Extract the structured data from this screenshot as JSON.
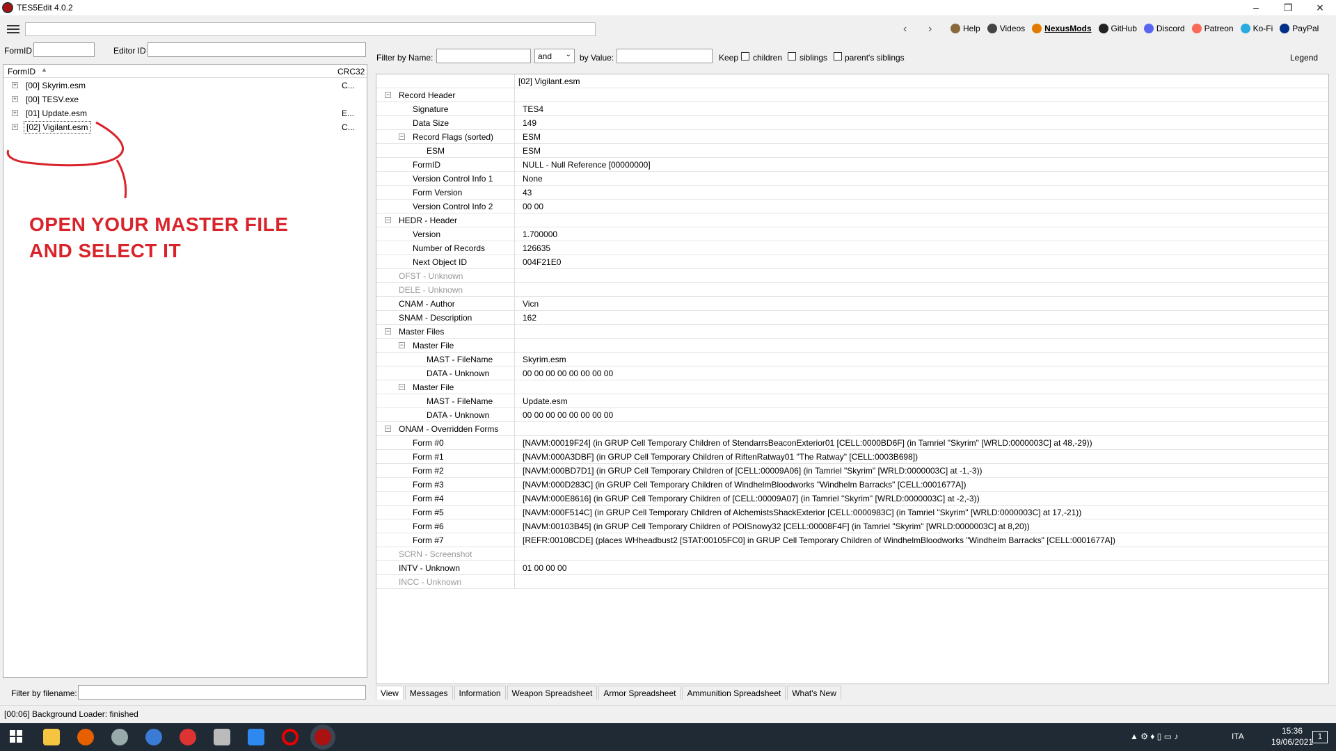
{
  "window": {
    "title": "TES5Edit 4.0.2",
    "minimize": "–",
    "maximize": "❐",
    "close": "✕"
  },
  "toolbar": {
    "links": [
      {
        "label": "Help",
        "color": "#8a6a3a"
      },
      {
        "label": "Videos",
        "color": "#444"
      },
      {
        "label": "NexusMods",
        "color": "#e07b00"
      },
      {
        "label": "GitHub",
        "color": "#222"
      },
      {
        "label": "Discord",
        "color": "#5865f2"
      },
      {
        "label": "Patreon",
        "color": "#f96854"
      },
      {
        "label": "Ko-Fi",
        "color": "#29abe0"
      },
      {
        "label": "PayPal",
        "color": "#003087"
      }
    ]
  },
  "left": {
    "formid_label": "FormID",
    "editorid_label": "Editor ID",
    "col_formid": "FormID",
    "col_crc": "CRC32",
    "files": [
      {
        "name": "[00] Skyrim.esm",
        "crc": "C..."
      },
      {
        "name": "[00] TESV.exe",
        "crc": ""
      },
      {
        "name": "[01] Update.esm",
        "crc": "E..."
      },
      {
        "name": "[02] Vigilant.esm",
        "crc": "C..."
      }
    ],
    "annotation_line1": "OPEN YOUR MASTER FILE",
    "annotation_line2": "AND SELECT IT",
    "filter_label": "Filter by filename:"
  },
  "right": {
    "filter_name_label": "Filter by Name:",
    "op_value": "and",
    "by_value_label": "by Value:",
    "keep_label": "Keep",
    "children_label": "children",
    "siblings_label": "siblings",
    "parents_siblings_label": "parent's siblings",
    "legend_label": "Legend",
    "header_file": "[02] Vigilant.esm",
    "rows": [
      {
        "k": "Record Header",
        "v": "",
        "lvl": 1,
        "exp": true
      },
      {
        "k": "Signature",
        "v": "TES4",
        "lvl": 2
      },
      {
        "k": "Data Size",
        "v": "149",
        "lvl": 2
      },
      {
        "k": "Record Flags (sorted)",
        "v": "ESM",
        "lvl": 2,
        "exp": true
      },
      {
        "k": "ESM",
        "v": "ESM",
        "lvl": 3
      },
      {
        "k": "FormID",
        "v": "NULL - Null Reference [00000000]",
        "lvl": 2
      },
      {
        "k": "Version Control Info 1",
        "v": "None",
        "lvl": 2
      },
      {
        "k": "Form Version",
        "v": "43",
        "lvl": 2
      },
      {
        "k": "Version Control Info 2",
        "v": "00 00",
        "lvl": 2
      },
      {
        "k": "HEDR - Header",
        "v": "",
        "lvl": 1,
        "exp": true
      },
      {
        "k": "Version",
        "v": "1.700000",
        "lvl": 2
      },
      {
        "k": "Number of Records",
        "v": "126635",
        "lvl": 2
      },
      {
        "k": "Next Object ID",
        "v": "004F21E0",
        "lvl": 2
      },
      {
        "k": "OFST - Unknown",
        "v": "",
        "lvl": 1,
        "dim": true
      },
      {
        "k": "DELE - Unknown",
        "v": "",
        "lvl": 1,
        "dim": true
      },
      {
        "k": "CNAM - Author",
        "v": "Vicn",
        "lvl": 1
      },
      {
        "k": "SNAM - Description",
        "v": "162",
        "lvl": 1
      },
      {
        "k": "Master Files",
        "v": "",
        "lvl": 1,
        "exp": true
      },
      {
        "k": "Master File",
        "v": "",
        "lvl": 2,
        "exp": true
      },
      {
        "k": "MAST - FileName",
        "v": "Skyrim.esm",
        "lvl": 3
      },
      {
        "k": "DATA - Unknown",
        "v": "00 00 00 00 00 00 00 00",
        "lvl": 3
      },
      {
        "k": "Master File",
        "v": "",
        "lvl": 2,
        "exp": true
      },
      {
        "k": "MAST - FileName",
        "v": "Update.esm",
        "lvl": 3
      },
      {
        "k": "DATA - Unknown",
        "v": "00 00 00 00 00 00 00 00",
        "lvl": 3
      },
      {
        "k": "ONAM - Overridden Forms",
        "v": "",
        "lvl": 1,
        "exp": true
      },
      {
        "k": "Form #0",
        "v": "[NAVM:00019F24] (in GRUP Cell Temporary Children of StendarrsBeaconExterior01 [CELL:0000BD6F] (in Tamriel \"Skyrim\" [WRLD:0000003C] at 48,-29))",
        "lvl": 2
      },
      {
        "k": "Form #1",
        "v": "[NAVM:000A3DBF] (in GRUP Cell Temporary Children of RiftenRatway01 \"The Ratway\" [CELL:0003B698])",
        "lvl": 2
      },
      {
        "k": "Form #2",
        "v": "[NAVM:000BD7D1] (in GRUP Cell Temporary Children of [CELL:00009A06] (in Tamriel \"Skyrim\" [WRLD:0000003C] at -1,-3))",
        "lvl": 2
      },
      {
        "k": "Form #3",
        "v": "[NAVM:000D283C] (in GRUP Cell Temporary Children of WindhelmBloodworks \"Windhelm Barracks\" [CELL:0001677A])",
        "lvl": 2
      },
      {
        "k": "Form #4",
        "v": "[NAVM:000E8616] (in GRUP Cell Temporary Children of [CELL:00009A07] (in Tamriel \"Skyrim\" [WRLD:0000003C] at -2,-3))",
        "lvl": 2
      },
      {
        "k": "Form #5",
        "v": "[NAVM:000F514C] (in GRUP Cell Temporary Children of AlchemistsShackExterior [CELL:0000983C] (in Tamriel \"Skyrim\" [WRLD:0000003C] at 17,-21))",
        "lvl": 2
      },
      {
        "k": "Form #6",
        "v": "[NAVM:00103B45] (in GRUP Cell Temporary Children of POISnowy32 [CELL:00008F4F] (in Tamriel \"Skyrim\" [WRLD:0000003C] at 8,20))",
        "lvl": 2
      },
      {
        "k": "Form #7",
        "v": "[REFR:00108CDE] (places WHheadbust2 [STAT:00105FC0] in GRUP Cell Temporary Children of WindhelmBloodworks \"Windhelm Barracks\" [CELL:0001677A])",
        "lvl": 2
      },
      {
        "k": "SCRN - Screenshot",
        "v": "",
        "lvl": 1,
        "dim": true
      },
      {
        "k": "INTV - Unknown",
        "v": "01 00 00 00",
        "lvl": 1
      },
      {
        "k": "INCC - Unknown",
        "v": "",
        "lvl": 1,
        "dim": true
      }
    ],
    "tabs": [
      "View",
      "Messages",
      "Information",
      "Weapon Spreadsheet",
      "Armor Spreadsheet",
      "Ammunition Spreadsheet",
      "What's New"
    ]
  },
  "status": "[00:06] Background Loader: finished",
  "taskbar": {
    "lang": "ITA",
    "time": "15:36",
    "date": "19/06/2021",
    "notif": "1"
  }
}
